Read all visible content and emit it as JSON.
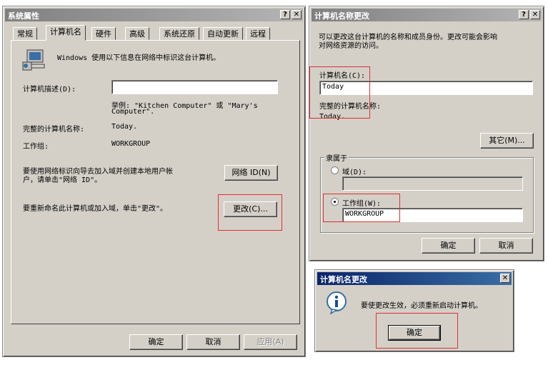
{
  "system_props": {
    "title": "系统属性",
    "tabs": [
      "常规",
      "计算机名",
      "硬件",
      "高级",
      "系统还原",
      "自动更新",
      "远程"
    ],
    "intro": "Windows 使用以下信息在网络中标识这台计算机。",
    "desc_label": "计算机描述(D):",
    "desc_value": "",
    "example": "举例: \"Kitchen Computer\" 或 \"Mary's",
    "example2": "Computer\".",
    "fullname_label": "完整的计算机名称:",
    "fullname_value": "Today.",
    "workgroup_label": "工作组:",
    "workgroup_value": "WORKGROUP",
    "netid_text1": "要使用网络标识向导去加入域并创建本地用户帐",
    "netid_text2": "户，请单击\"网络 ID\"。",
    "netid_button": "网络 ID(N)",
    "rename_text": "要重新命名此计算机或加入域，单击\"更改\"。",
    "change_button": "更改(C)...",
    "ok": "确定",
    "cancel": "取消",
    "apply": "应用(A)"
  },
  "rename_dialog": {
    "title": "计算机名称更改",
    "intro1": "可以更改这台计算机的名称和成员身份。更改可能会影响",
    "intro2": "对网络资源的访问。",
    "name_label": "计算机名(C):",
    "name_value": "Today",
    "fullname_label": "完整的计算机名称:",
    "fullname_value": "Today.",
    "other_button": "其它(M)...",
    "member_of": "隶属于",
    "domain_label": "域(D):",
    "domain_value": "",
    "workgroup_label": "工作组(W):",
    "workgroup_value": "WORKGROUP",
    "ok": "确定",
    "cancel": "取消"
  },
  "restart_dialog": {
    "title": "计算机名更改",
    "message": "要使更改生效，必须重新启动计算机。",
    "ok": "确定"
  },
  "icons": [
    "help-icon",
    "close-icon",
    "computer-icon",
    "info-icon"
  ]
}
